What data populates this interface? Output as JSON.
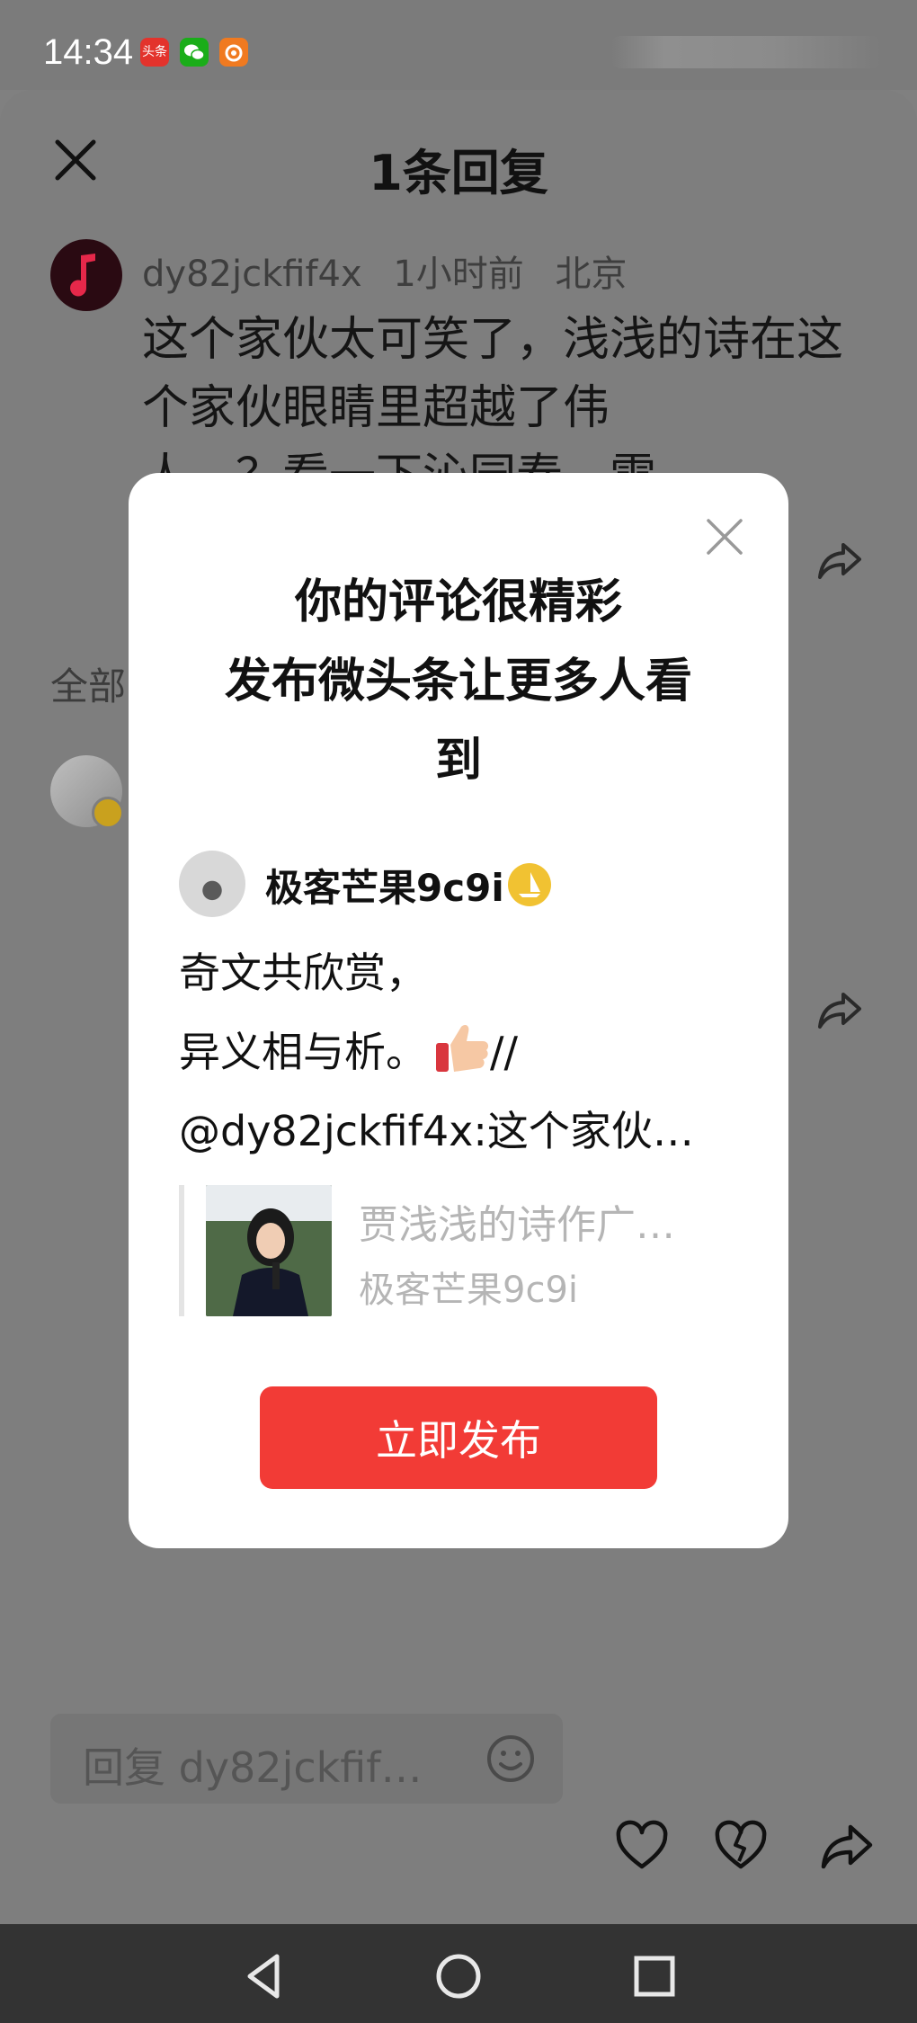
{
  "status_bar": {
    "time": "14:34",
    "icons": [
      {
        "name": "toutiao-icon",
        "label": "头条",
        "color": "#e3332c"
      },
      {
        "name": "wechat-icon",
        "label": "",
        "color": "#1aad19"
      },
      {
        "name": "app-icon",
        "label": "",
        "color": "#f07a20"
      }
    ]
  },
  "sheet": {
    "title": "1条回复",
    "comment": {
      "username": "dy82jckfif4x",
      "time": "1小时前",
      "location": "北京",
      "text": "这个家伙太可笑了，浅浅的诗在这个家伙眼睛里超越了伟",
      "text_cut": "人，？看一下沁园春，雷"
    },
    "section_label": "全部"
  },
  "bottom_bar": {
    "reply_placeholder": "回复 dy82jckfif…"
  },
  "modal": {
    "title_line1": "你的评论很精彩",
    "title_line2": "发布微头条让更多人看",
    "title_line3": "到",
    "username": "极客芒果9c9i",
    "body_line1": "奇文共欣赏，",
    "body_line2": "异义相与析。",
    "body_line2_suffix": "//",
    "body_line3": "@dy82jckfif4x:这个家伙…",
    "quote_title": "贾浅浅的诗作广…",
    "quote_author": "极客芒果9c9i",
    "publish_label": "立即发布"
  },
  "colors": {
    "accent": "#f23b36",
    "badge": "#f1c232",
    "overlay": "#808080"
  }
}
